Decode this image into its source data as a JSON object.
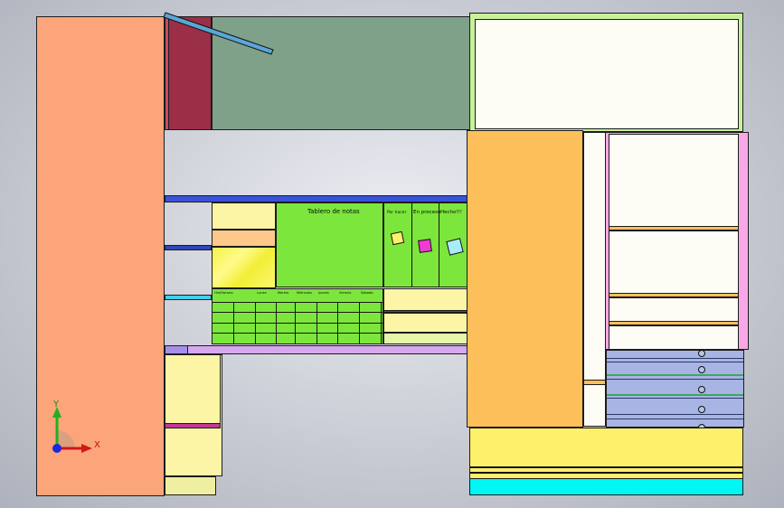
{
  "board": {
    "title": "Tablero de notas",
    "columns": [
      "Por hacer",
      "En proceso",
      "Hecho!!!"
    ]
  },
  "schedule": {
    "header": [
      "Hrs/Horario",
      "",
      "Lunes",
      "Martes",
      "Miércoles",
      "Jueves",
      "Viernes",
      "Sábado",
      "Domingo"
    ],
    "rows": [
      [
        "",
        "",
        "",
        "",
        "",
        "",
        "",
        "",
        ""
      ],
      [
        "",
        "",
        "",
        "",
        "",
        "",
        "",
        "",
        ""
      ],
      [
        "",
        "",
        "",
        "",
        "",
        "",
        "",
        "",
        ""
      ],
      [
        "",
        "",
        "",
        "",
        "",
        "",
        "",
        "",
        ""
      ]
    ]
  },
  "axes": {
    "y": "Y",
    "x": "X"
  },
  "colors": {
    "salmon": "#fca57a",
    "orange": "#fdbf5a",
    "sage": "#7fa18a",
    "maroon": "#9b2f48",
    "green": "#7ce63c",
    "yellow": "#fdf06a",
    "cream": "#fdf5a6",
    "cyan": "#00f7f5",
    "lilac": "#a78ee8",
    "periwinkle": "#a8b4e3"
  }
}
